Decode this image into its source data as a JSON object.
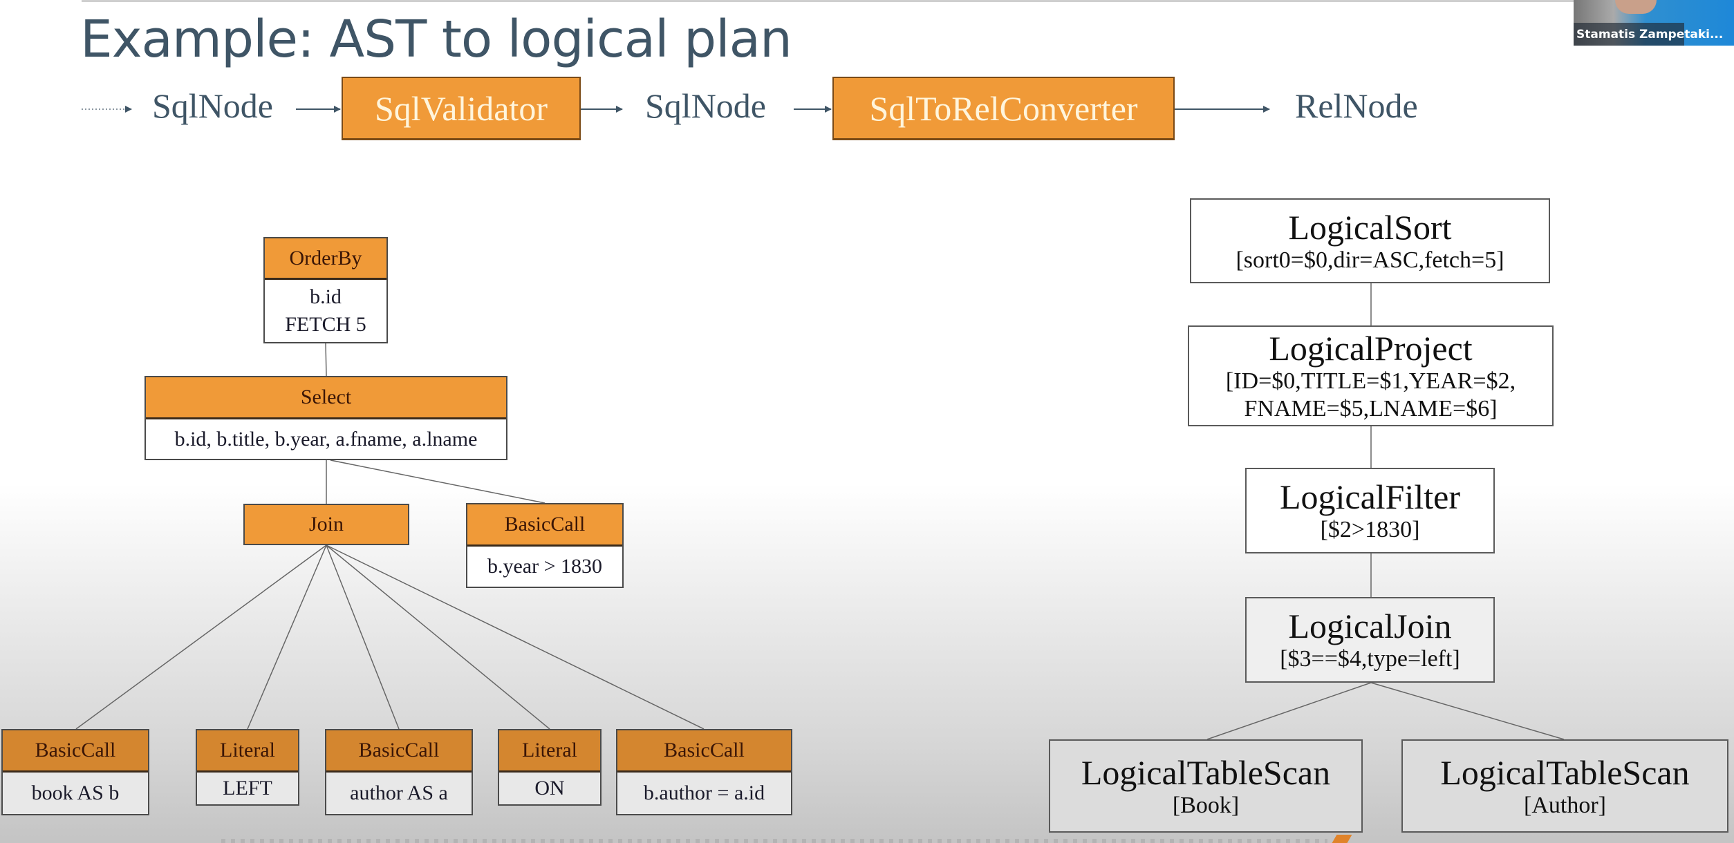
{
  "slide": {
    "title": "Example: AST to logical plan"
  },
  "pipeline": {
    "steps": [
      {
        "label": "SqlNode",
        "kind": "data"
      },
      {
        "label": "SqlValidator",
        "kind": "process"
      },
      {
        "label": "SqlNode",
        "kind": "data"
      },
      {
        "label": "SqlToRelConverter",
        "kind": "process"
      },
      {
        "label": "RelNode",
        "kind": "data"
      }
    ]
  },
  "ast": {
    "order_by": {
      "type": "OrderBy",
      "lines": [
        "b.id",
        "FETCH 5"
      ]
    },
    "select": {
      "type": "Select",
      "lines": [
        "b.id, b.title, b.year, a.fname, a.lname"
      ]
    },
    "join": {
      "type": "Join"
    },
    "where": {
      "type": "BasicCall",
      "lines": [
        "b.year > 1830"
      ]
    },
    "join_children": [
      {
        "type": "BasicCall",
        "value": "book AS b"
      },
      {
        "type": "Literal",
        "value": "LEFT"
      },
      {
        "type": "BasicCall",
        "value": "author AS a"
      },
      {
        "type": "Literal",
        "value": "ON"
      },
      {
        "type": "BasicCall",
        "value": "b.author = a.id"
      }
    ]
  },
  "logical_plan": {
    "sort": {
      "name": "LogicalSort",
      "args": [
        "[sort0=$0,dir=ASC,fetch=5]"
      ]
    },
    "project": {
      "name": "LogicalProject",
      "args": [
        "[ID=$0,TITLE=$1,YEAR=$2,",
        "FNAME=$5,LNAME=$6]"
      ]
    },
    "filter": {
      "name": "LogicalFilter",
      "args": [
        "[$2>1830]"
      ]
    },
    "join": {
      "name": "LogicalJoin",
      "args": [
        "[$3==$4,type=left]"
      ]
    },
    "scan_book": {
      "name": "LogicalTableScan",
      "args": [
        "[Book]"
      ]
    },
    "scan_author": {
      "name": "LogicalTableScan",
      "args": [
        "[Author]"
      ]
    }
  },
  "webcam": {
    "participant_name": "Stamatis Zampetaki..."
  },
  "colors": {
    "accent_orange": "#f09a38",
    "title_slate": "#3f5566"
  }
}
